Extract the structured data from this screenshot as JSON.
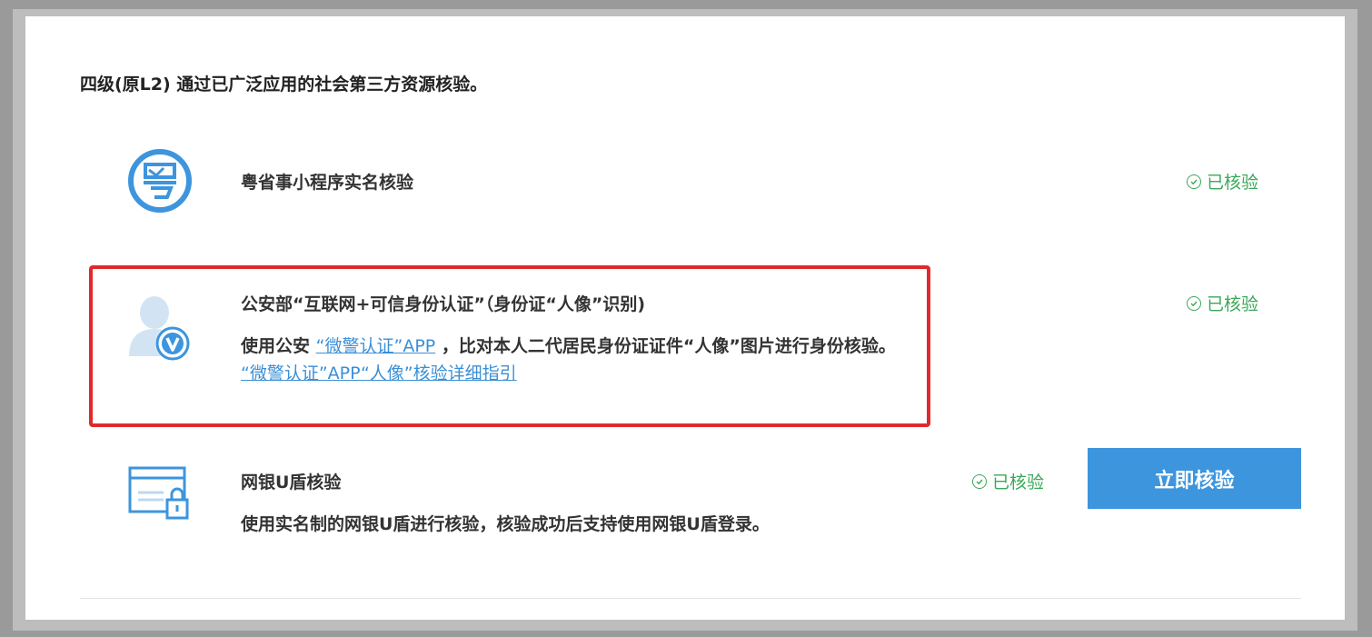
{
  "level_title": "四级(原L2) 通过已广泛应用的社会第三方资源核验。",
  "items": [
    {
      "icon": "yue-logo-icon",
      "title": "粤省事小程序实名核验",
      "status": "已核验"
    },
    {
      "icon": "user-verified-icon",
      "title": "公安部“互联网+可信身份认证”（身份证“人像”识别)",
      "desc_prefix": "使用公安",
      "desc_link1": "“微警认证”APP",
      "desc_mid": "，比对本人二代居民身份证证件“人像”图片进行身份核验。",
      "desc_link2": "“微警认证”APP“人像”核验详细指引",
      "status": "已核验"
    },
    {
      "icon": "bank-ukey-icon",
      "title": "网银U盾核验",
      "desc": "使用实名制的网银U盾进行核验，核验成功后支持使用网银U盾登录。",
      "status": "已核验",
      "button": "立即核验"
    }
  ],
  "colors": {
    "accent": "#3d95de",
    "status_green": "#3aa858",
    "highlight_red": "#e02a2a"
  }
}
